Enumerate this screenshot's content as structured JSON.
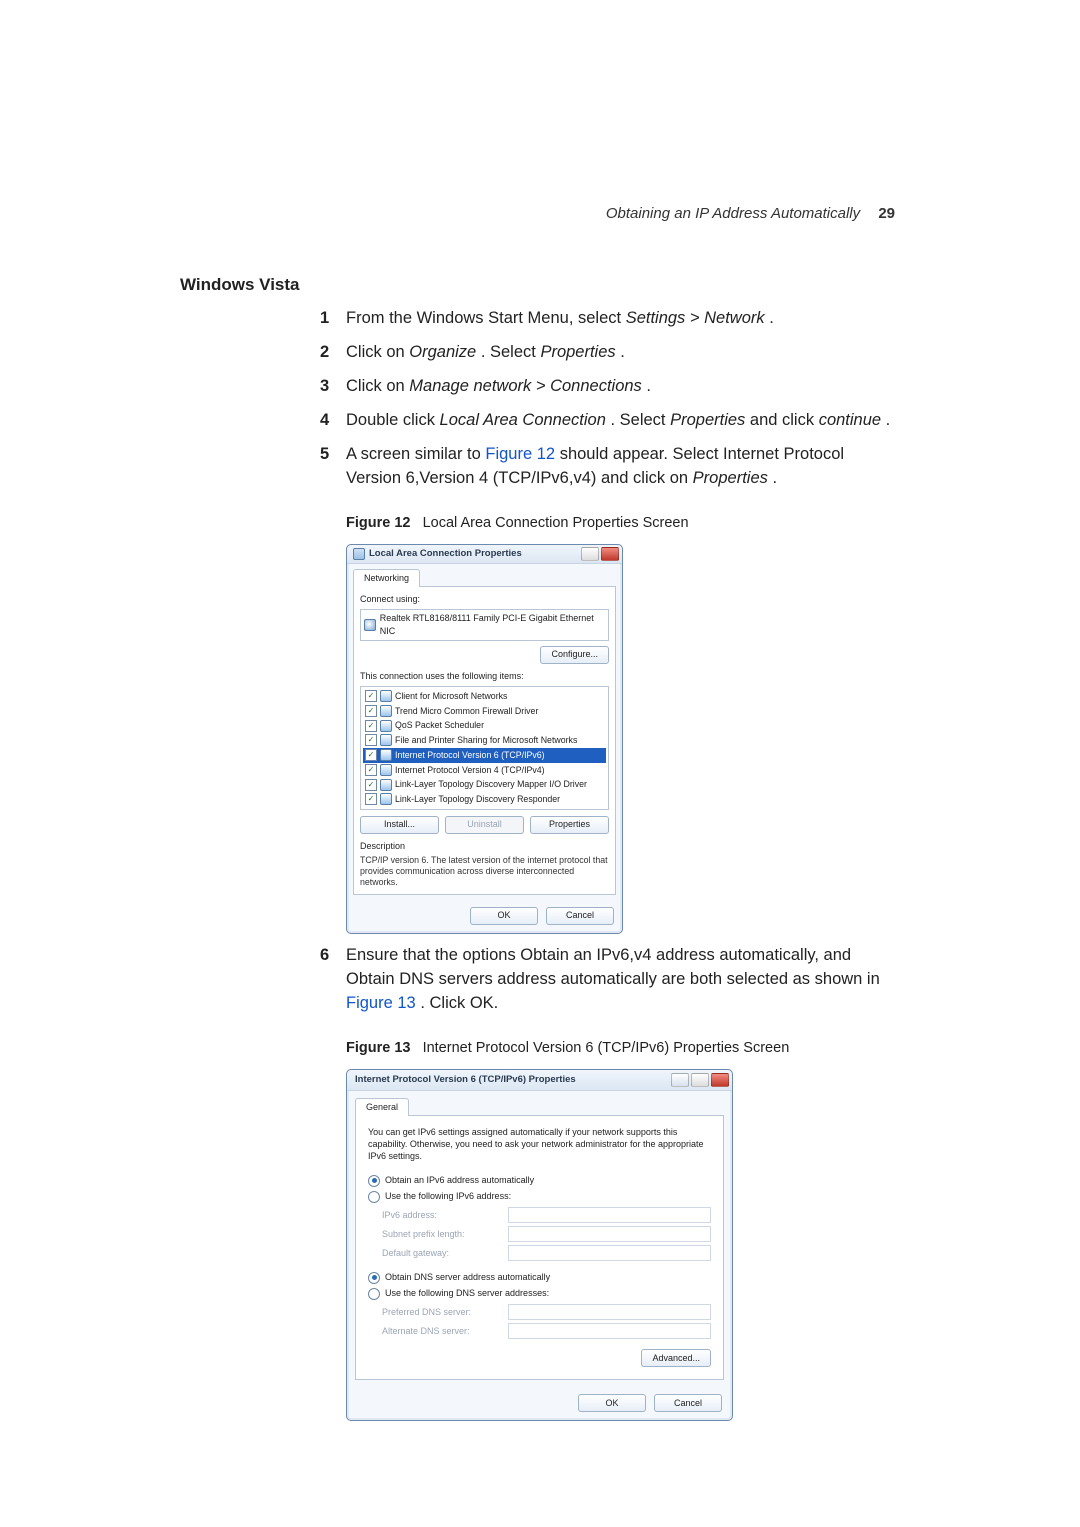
{
  "running_head": {
    "title": "Obtaining an IP Address Automatically",
    "page": "29"
  },
  "section_title": "Windows Vista",
  "steps": {
    "s1": {
      "pre": "From the Windows Start Menu, select ",
      "i1": "Settings > Network",
      "post": "."
    },
    "s2": {
      "pre": "Click on ",
      "i1": "Organize",
      "mid": ". Select ",
      "i2": "Properties",
      "post": "."
    },
    "s3": {
      "pre": "Click on ",
      "i1": "Manage network > Connections",
      "post": "."
    },
    "s4": {
      "pre": "Double click ",
      "i1": "Local Area Connection",
      "mid": ". Select ",
      "i2": "Properties",
      "mid2": " and click ",
      "i3": "continue",
      "post": "."
    },
    "s5": {
      "pre": "A screen similar to ",
      "link": "Figure 12",
      "mid": " should appear. Select Internet Protocol Version 6,Version 4 (TCP/IPv6,v4) and click on ",
      "i1": "Properties",
      "post": "."
    },
    "s6": {
      "pre": "Ensure that the options Obtain an IPv6,v4 address automatically, and Obtain DNS servers address automatically are both selected as shown in ",
      "link": "Figure 13",
      "post": ". Click OK."
    }
  },
  "fig12": {
    "caption_label": "Figure 12",
    "caption_text": "Local Area Connection Properties Screen",
    "title": "Local Area Connection Properties",
    "tab": "Networking",
    "connect_label": "Connect using:",
    "nic": "Realtek RTL8168/8111 Family PCI-E Gigabit Ethernet NIC",
    "configure": "Configure...",
    "uses_label": "This connection uses the following items:",
    "items": [
      "Client for Microsoft Networks",
      "Trend Micro Common Firewall Driver",
      "QoS Packet Scheduler",
      "File and Printer Sharing for Microsoft Networks",
      "Internet Protocol Version 6 (TCP/IPv6)",
      "Internet Protocol Version 4 (TCP/IPv4)",
      "Link-Layer Topology Discovery Mapper I/O Driver",
      "Link-Layer Topology Discovery Responder"
    ],
    "install": "Install...",
    "uninstall": "Uninstall",
    "properties": "Properties",
    "desc_label": "Description",
    "desc": "TCP/IP version 6. The latest version of the internet protocol that provides communication across diverse interconnected networks.",
    "ok": "OK",
    "cancel": "Cancel"
  },
  "fig13": {
    "caption_label": "Figure 13",
    "caption_text": "Internet Protocol Version 6 (TCP/IPv6) Properties Screen",
    "title": "Internet Protocol Version 6 (TCP/IPv6) Properties",
    "tab": "General",
    "info": "You can get IPv6 settings assigned automatically if your network supports this capability. Otherwise, you need to ask your network administrator for the appropriate IPv6 settings.",
    "radio_auto_addr": "Obtain an IPv6 address automatically",
    "radio_use_addr": "Use the following IPv6 address:",
    "ipv6_addr": "IPv6 address:",
    "prefix": "Subnet prefix length:",
    "gateway": "Default gateway:",
    "radio_auto_dns": "Obtain DNS server address automatically",
    "radio_use_dns": "Use the following DNS server addresses:",
    "pref_dns": "Preferred DNS server:",
    "alt_dns": "Alternate DNS server:",
    "advanced": "Advanced...",
    "ok": "OK",
    "cancel": "Cancel"
  }
}
